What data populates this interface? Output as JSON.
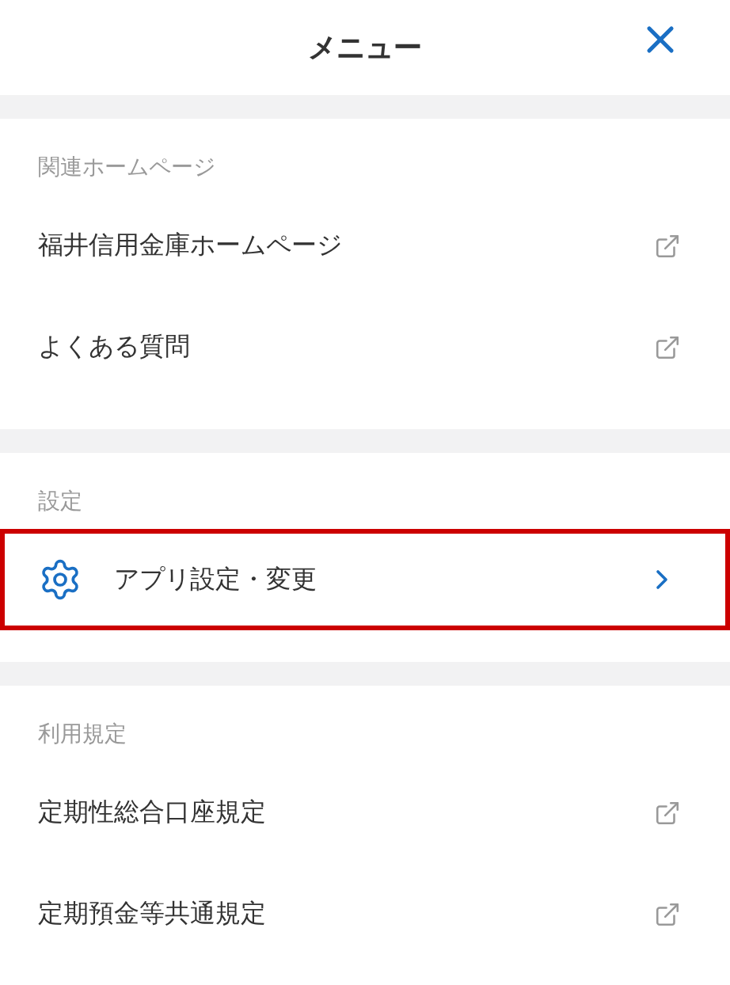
{
  "header": {
    "title": "メニュー"
  },
  "sections": [
    {
      "title": "関連ホームページ",
      "items": [
        {
          "label": "福井信用金庫ホームページ",
          "kind": "external",
          "highlighted": false
        },
        {
          "label": "よくある質問",
          "kind": "external",
          "highlighted": false
        }
      ]
    },
    {
      "title": "設定",
      "items": [
        {
          "label": "アプリ設定・変更",
          "kind": "settings",
          "highlighted": true
        }
      ]
    },
    {
      "title": "利用規定",
      "items": [
        {
          "label": "定期性総合口座規定",
          "kind": "external",
          "highlighted": false
        },
        {
          "label": "定期預金等共通規定",
          "kind": "external",
          "highlighted": false
        }
      ]
    }
  ]
}
